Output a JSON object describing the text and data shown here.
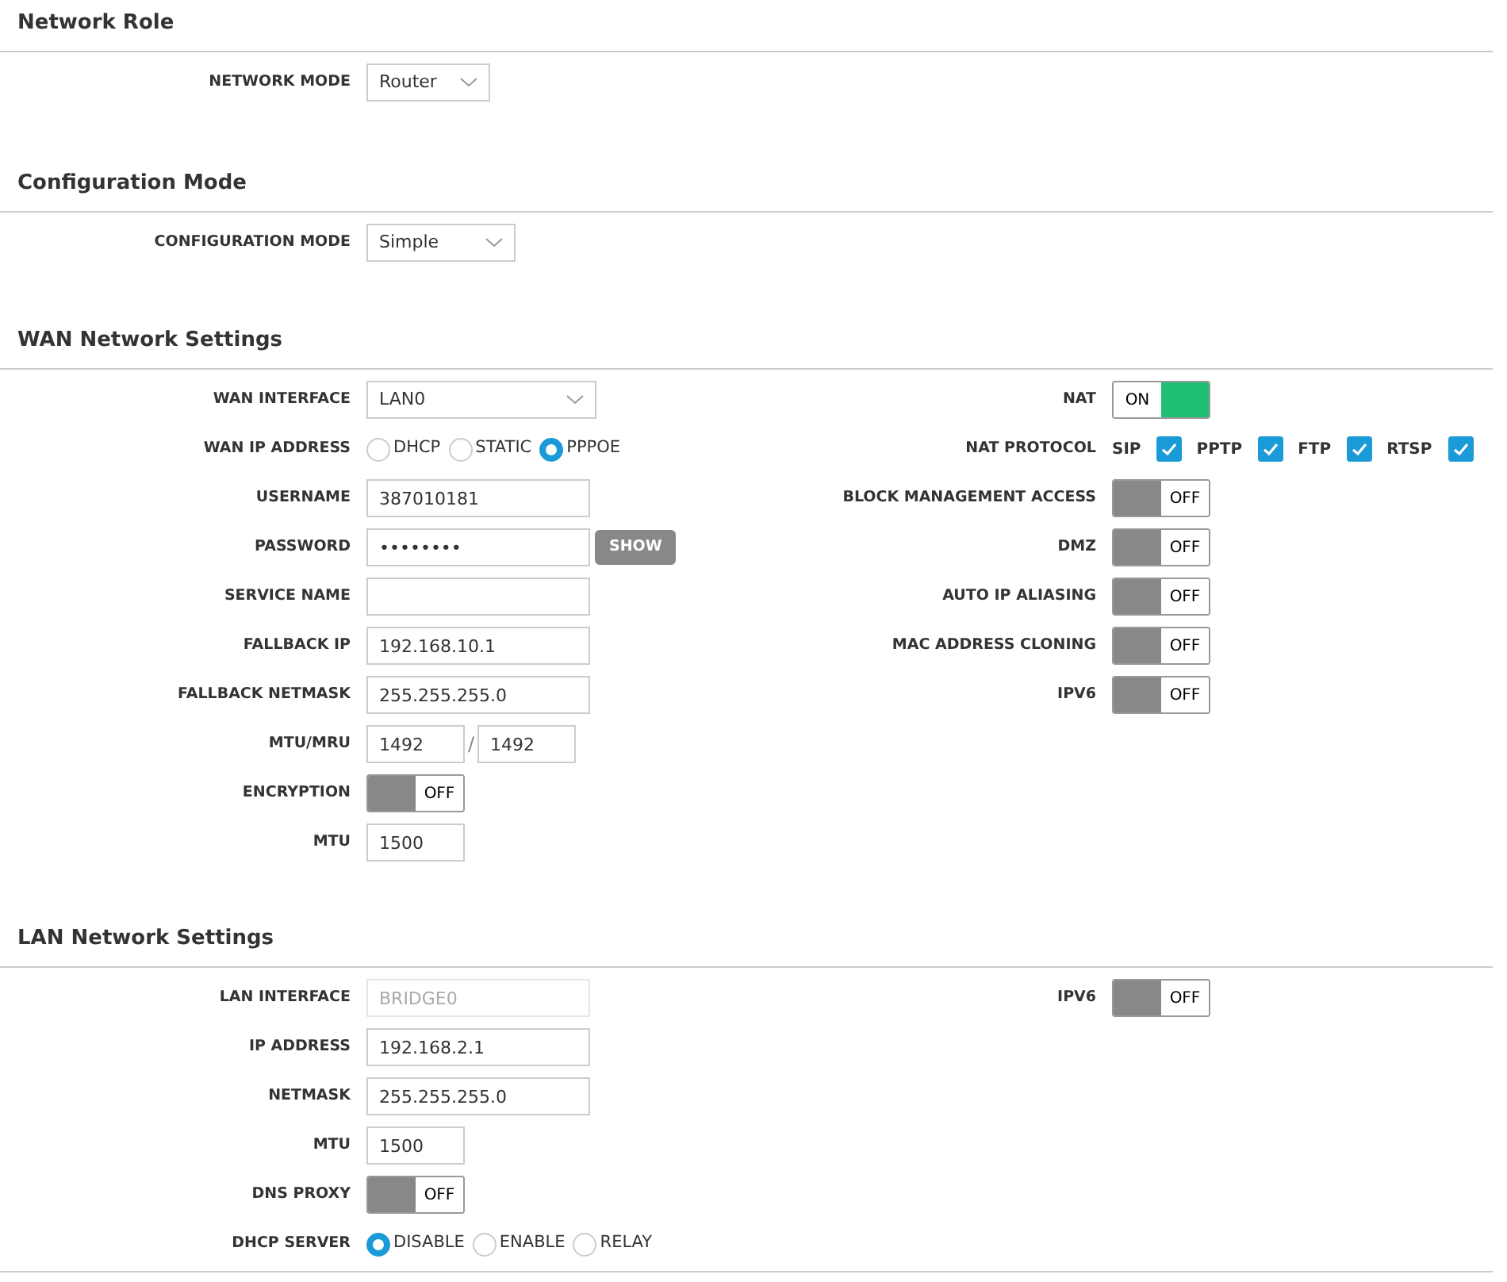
{
  "sections": [
    {
      "title": "Network Role",
      "left": [
        {
          "kind": "select",
          "label": "NETWORK MODE",
          "value": "Router"
        }
      ]
    },
    {
      "title": "Configuration Mode",
      "left": [
        {
          "kind": "select",
          "label": "CONFIGURATION MODE",
          "value": "Simple"
        }
      ]
    },
    {
      "title": "WAN Network Settings",
      "left": [
        {
          "kind": "select",
          "label": "WAN INTERFACE",
          "value": "LAN0"
        },
        {
          "kind": "radio",
          "label": "WAN IP ADDRESS",
          "options": [
            {
              "label": "DHCP",
              "selected": false
            },
            {
              "label": "STATIC",
              "selected": false
            },
            {
              "label": "PPPOE",
              "selected": true
            }
          ]
        },
        {
          "kind": "text",
          "label": "USERNAME",
          "value": "387010181",
          "disabled": false
        },
        {
          "kind": "password",
          "label": "PASSWORD",
          "value": "••••••••",
          "button": "SHOW"
        },
        {
          "kind": "text",
          "label": "SERVICE NAME",
          "disabled": false
        },
        {
          "kind": "text",
          "label": "FALLBACK IP",
          "value": "192.168.10.1",
          "disabled": false
        },
        {
          "kind": "text",
          "label": "FALLBACK NETMASK",
          "value": "255.255.255.0",
          "disabled": false
        },
        {
          "kind": "pair",
          "label": "MTU/MRU",
          "values": [
            "1492",
            "1492"
          ],
          "separator": "/"
        },
        {
          "kind": "toggle",
          "label": "ENCRYPTION",
          "on": false,
          "text": "OFF"
        },
        {
          "kind": "number",
          "label": "MTU",
          "value": "1500"
        }
      ],
      "right": [
        {
          "kind": "toggle",
          "label": "NAT",
          "on": true,
          "text": "ON"
        },
        {
          "kind": "checks",
          "label": "NAT PROTOCOL",
          "options": [
            {
              "label": "SIP",
              "checked": true
            },
            {
              "label": "PPTP",
              "checked": true
            },
            {
              "label": "FTP",
              "checked": true
            },
            {
              "label": "RTSP",
              "checked": true
            }
          ]
        },
        {
          "kind": "toggle",
          "label": "BLOCK MANAGEMENT ACCESS",
          "on": false,
          "text": "OFF"
        },
        {
          "kind": "toggle",
          "label": "DMZ",
          "on": false,
          "text": "OFF"
        },
        {
          "kind": "toggle",
          "label": "AUTO IP ALIASING",
          "on": false,
          "text": "OFF"
        },
        {
          "kind": "toggle",
          "label": "MAC ADDRESS CLONING",
          "on": false,
          "text": "OFF"
        },
        {
          "kind": "toggle",
          "label": "IPV6",
          "on": false,
          "text": "OFF"
        }
      ]
    },
    {
      "title": "LAN Network Settings",
      "left": [
        {
          "kind": "text",
          "label": "LAN INTERFACE",
          "value": "BRIDGE0",
          "disabled": true
        },
        {
          "kind": "text",
          "label": "IP ADDRESS",
          "value": "192.168.2.1",
          "disabled": false
        },
        {
          "kind": "text",
          "label": "NETMASK",
          "value": "255.255.255.0",
          "disabled": false
        },
        {
          "kind": "number",
          "label": "MTU",
          "value": "1500"
        },
        {
          "kind": "toggle",
          "label": "DNS PROXY",
          "on": false,
          "text": "OFF"
        },
        {
          "kind": "radio",
          "label": "DHCP SERVER",
          "options": [
            {
              "label": "DISABLE",
              "selected": true
            },
            {
              "label": "ENABLE",
              "selected": false
            },
            {
              "label": "RELAY",
              "selected": false
            }
          ]
        }
      ],
      "right": [
        {
          "kind": "toggle",
          "label": "IPV6",
          "on": false,
          "text": "OFF"
        }
      ]
    }
  ]
}
